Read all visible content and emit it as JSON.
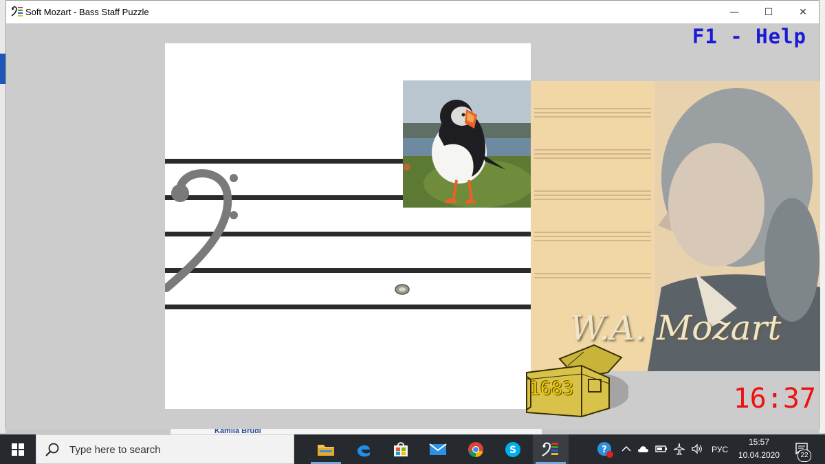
{
  "window": {
    "title": "Soft Mozart - Bass Staff Puzzle",
    "min_label": "—",
    "max_label": "☐",
    "close_label": "✕"
  },
  "game": {
    "help_hint": "F1 - Help",
    "score": "1683",
    "clock": "16:37",
    "portrait_caption": "W.A. Mozart"
  },
  "taskbar": {
    "search_placeholder": "Type here to search",
    "apps": [
      "file-explorer-icon",
      "edge-icon",
      "store-icon",
      "mail-icon",
      "chrome-icon",
      "skype-icon",
      "soft-mozart-icon"
    ],
    "input_language": "РУС",
    "time": "15:57",
    "date": "10.04.2020",
    "notification_count": "22"
  },
  "desktop": {
    "background_text": "Kamila Brudi"
  },
  "colors": {
    "help_text": "#1a1ad6",
    "clock": "#ee1111",
    "score": "#f0c800",
    "taskbar": "#26292d"
  }
}
